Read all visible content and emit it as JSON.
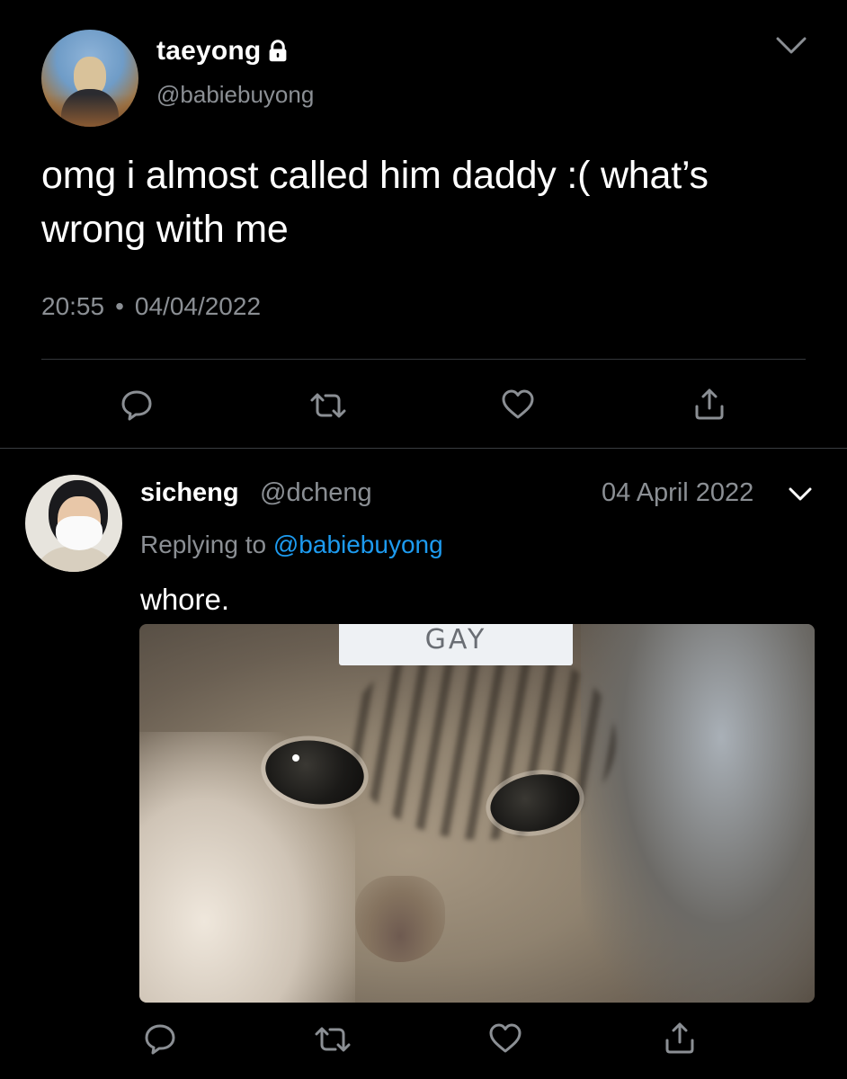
{
  "tweet": {
    "author": {
      "display_name": "taeyong",
      "handle": "@babiebuyong",
      "protected_icon": "lock-icon"
    },
    "text": "omg i almost called him daddy :( what’s wrong with me",
    "time": "20:55",
    "separator": "•",
    "date": "04/04/2022",
    "menu_icon": "chevron-down-icon",
    "actions": [
      "reply-icon",
      "retweet-icon",
      "like-icon",
      "share-icon"
    ]
  },
  "reply": {
    "author": {
      "display_name": "sicheng",
      "handle": "@dcheng"
    },
    "date": "04 April 2022",
    "replying_prefix": "Replying to",
    "replying_to": "@babiebuyong",
    "text": "whore.",
    "media": {
      "label_text": "GAY"
    },
    "actions": [
      "reply-icon",
      "retweet-icon",
      "like-icon",
      "share-icon"
    ]
  },
  "colors": {
    "background": "#000000",
    "text": "#ffffff",
    "muted": "#8b8f94",
    "link": "#1d9bf0",
    "divider": "#34373b"
  }
}
